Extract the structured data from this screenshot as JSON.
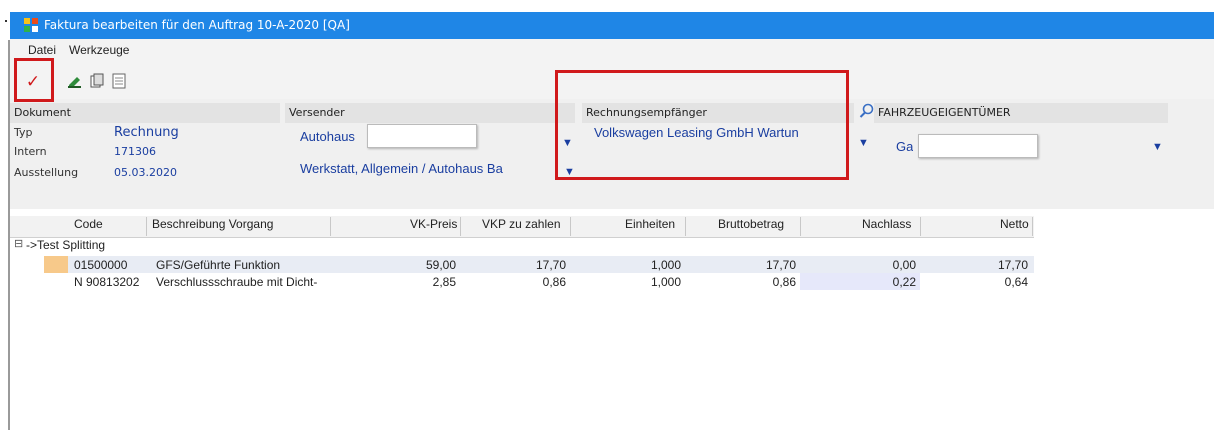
{
  "window": {
    "title": "Faktura bearbeiten für den Auftrag 10-A-2020 [QA]"
  },
  "menu": {
    "datei": "Datei",
    "werkzeuge": "Werkzeuge"
  },
  "toolbar": {
    "icons": [
      "checkmark-icon",
      "edit-icon",
      "copy-icon",
      "document-icon"
    ]
  },
  "dokument": {
    "header": "Dokument",
    "typ_label": "Typ",
    "typ_value": "Rechnung",
    "intern_label": "Intern",
    "intern_value": "171306",
    "ausstellung_label": "Ausstellung",
    "ausstellung_value": "05.03.2020"
  },
  "versender": {
    "header": "Versender",
    "line1": "Autohaus",
    "line2": "Werkstatt,  Allgemein / Autohaus Ba"
  },
  "rechnungsempfaenger": {
    "header": "Rechnungsempfänger",
    "value": "Volkswagen  Leasing  GmbH  Wartun"
  },
  "fahrzeugeigentuemer": {
    "header": "FAHRZEUGEIGENTÜMER",
    "value": "Ga"
  },
  "table": {
    "columns": [
      "Code",
      "Beschreibung Vorgang",
      "VK-Preis",
      "VKP zu zahlen",
      "Einheiten",
      "Bruttobetrag",
      "Nachlass",
      "Netto"
    ],
    "group_label": "->Test Splitting",
    "group_toggle": "⊟",
    "rows": [
      {
        "code": "01500000",
        "beschreibung": "GFS/Geführte Funktion",
        "vk_preis": "59,00",
        "vkp_zu_zahlen": "17,70",
        "einheiten": "1,000",
        "bruttobetrag": "17,70",
        "nachlass": "0,00",
        "netto": "17,70"
      },
      {
        "code": "N  90813202",
        "beschreibung": "Verschlussschraube mit Dicht-",
        "vk_preis": "2,85",
        "vkp_zu_zahlen": "0,86",
        "einheiten": "1,000",
        "bruttobetrag": "0,86",
        "nachlass": "0,22",
        "netto": "0,64"
      }
    ]
  },
  "colors": {
    "titlebar": "#1f86e6",
    "highlight_red": "#d0191b",
    "value_blue": "#1a3ea0",
    "selected_row": "#e8ecf4",
    "nachlass_cell": "#e6e8fa"
  }
}
